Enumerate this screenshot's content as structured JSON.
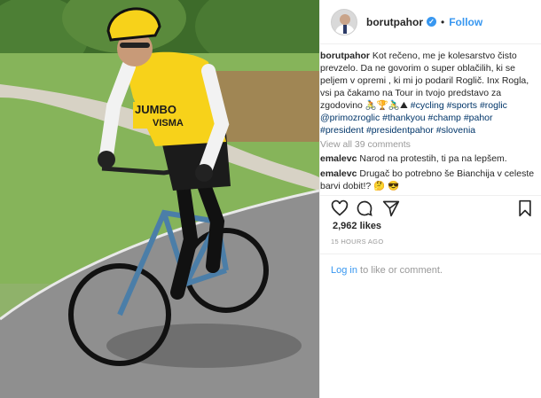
{
  "post": {
    "username": "borutpahor",
    "verified_icon": "verified-badge-icon",
    "follow_separator": "•",
    "follow_label": "Follow",
    "caption_user": "borutpahor",
    "caption_text": "Kot rečeno, me je kolesarstvo čisto prevzelo. Da ne govorim o super oblačilih, ki se peljem v opremi , ki mi jo podaril Roglič. Inx Rogla, vsi pa čakamo na Tour in tvojo predstavo za zgodovino 🚴🏆🚴‍♂️⛰",
    "caption_hashtags": "#cycling #sports #roglic @primozroglic #thankyou #champ #pahor #president #presidentpahor #slovenia",
    "view_all": "View all 39 comments",
    "comments": [
      {
        "user": "emalevc",
        "text": "Narod na protestih, ti pa na lepšem."
      },
      {
        "user": "emalevc",
        "text": "Drugač bo potrebno še Bianchija v celeste barvi dobit!? 🤔 😎"
      }
    ],
    "likes": "2,962 likes",
    "time": "15 HOURS AGO",
    "login_link": "Log in",
    "login_suffix": " to like or comment."
  },
  "icons": [
    "heart-icon",
    "comment-icon",
    "share-icon",
    "bookmark-icon"
  ],
  "colors": {
    "accent": "#3897f0",
    "hashtag": "#003569",
    "jersey_yellow": "#f7d21a",
    "text": "#262626",
    "muted": "#999999"
  }
}
